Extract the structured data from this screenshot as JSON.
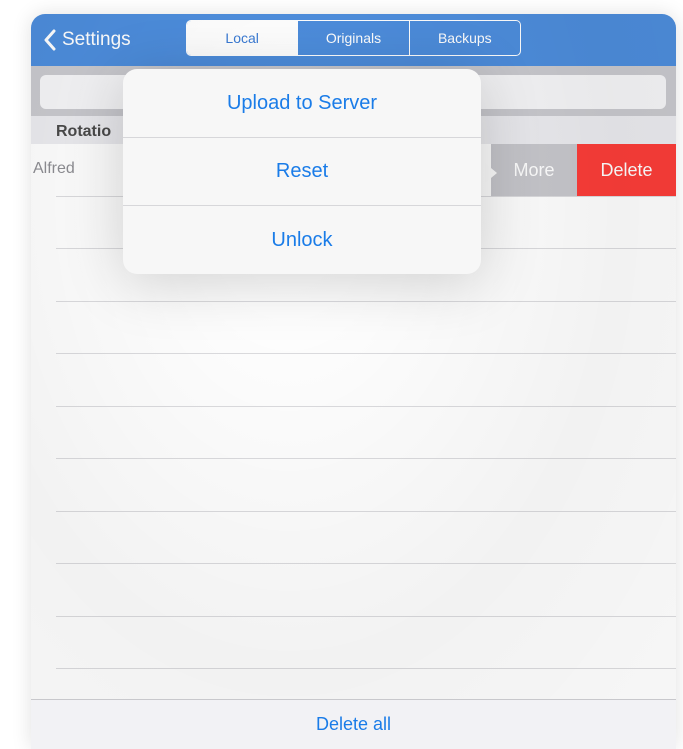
{
  "navbar": {
    "back_label": "Settings",
    "tabs": [
      {
        "label": "Local",
        "active": true
      },
      {
        "label": "Originals",
        "active": false
      },
      {
        "label": "Backups",
        "active": false
      }
    ]
  },
  "section": {
    "header": "Rotatio"
  },
  "row": {
    "title": "Alfred",
    "actions": {
      "more": "More",
      "delete": "Delete"
    }
  },
  "popover": {
    "items": [
      "Upload to Server",
      "Reset",
      "Unlock"
    ]
  },
  "toolbar": {
    "delete_all": "Delete all"
  },
  "colors": {
    "nav_bar": "#4d8ddc",
    "tint": "#1a7ce8",
    "delete": "#fc3d39",
    "more": "#c7c7cc"
  },
  "icons": {
    "back": "chevron-left-icon"
  }
}
